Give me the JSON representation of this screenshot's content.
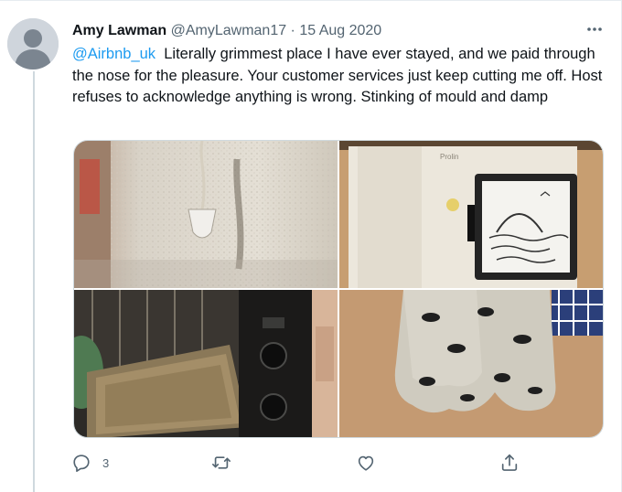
{
  "tweet": {
    "author_name": "Amy Lawman",
    "author_handle": "@AmyLawman17",
    "separator": " · ",
    "date": "15 Aug 2020",
    "mention": "@Airbnb_uk",
    "body": "  Literally grimmest place I have ever stayed, and we paid through the nose for the pleasure. Your customer services just keep cutting me off. Host refuses to acknowledge anything is wrong. Stinking of mould and damp"
  },
  "stats": {
    "reply_count": "3"
  },
  "media": {
    "images": [
      {
        "subject": "stained-wall-with-cord-pull"
      },
      {
        "subject": "fridge-with-whiteboard"
      },
      {
        "subject": "dirty-oven-tray"
      },
      {
        "subject": "penguin-oven-gloves"
      }
    ]
  },
  "icons": {
    "more": "more-icon",
    "reply": "reply-icon",
    "retweet": "retweet-icon",
    "like": "like-icon",
    "share": "share-icon"
  },
  "colors": {
    "link": "#1d9bf0",
    "secondary_text": "#536471",
    "primary_text": "#0f1419",
    "divider": "#cfd9de"
  }
}
